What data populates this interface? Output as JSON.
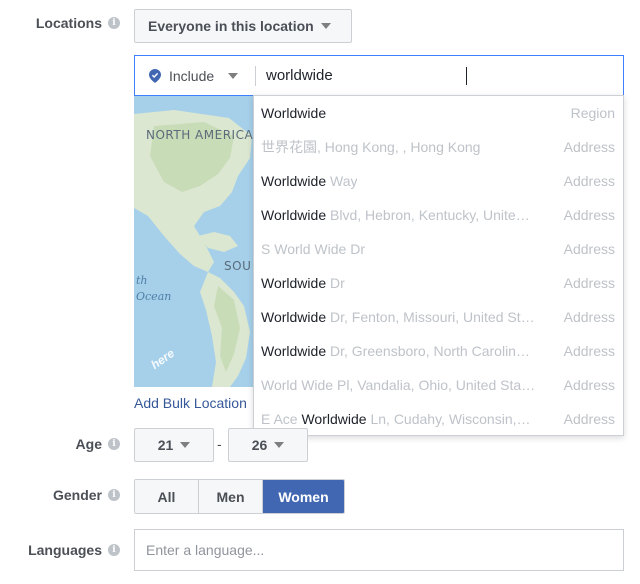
{
  "labels": {
    "locations": "Locations",
    "age": "Age",
    "gender": "Gender",
    "languages": "Languages",
    "info_glyph": "i"
  },
  "audience_type": "Everyone in this location",
  "location_search": {
    "mode": "Include",
    "query": "worldwide"
  },
  "map": {
    "labels": [
      "NORTH AMERICA",
      "SOU"
    ],
    "ocean": [
      "th",
      "Ocean"
    ],
    "provider_logo": "here"
  },
  "bulk_link": "Add Bulk Location",
  "suggestions": [
    {
      "match": "Worldwide",
      "rest": "",
      "type": "Region",
      "match_first": true
    },
    {
      "match": "",
      "rest": "世界花園, Hong Kong, , Hong Kong",
      "type": "Address",
      "match_first": true
    },
    {
      "match": "Worldwide",
      "rest": " Way",
      "type": "Address",
      "match_first": true
    },
    {
      "match": "Worldwide",
      "rest": " Blvd, Hebron, Kentucky, Unite…",
      "type": "Address",
      "match_first": true
    },
    {
      "match": "",
      "rest": "S World Wide Dr",
      "type": "Address",
      "match_first": true
    },
    {
      "match": "Worldwide",
      "rest": " Dr",
      "type": "Address",
      "match_first": true
    },
    {
      "match": "Worldwide",
      "rest": " Dr, Fenton, Missouri, United St…",
      "type": "Address",
      "match_first": true
    },
    {
      "match": "Worldwide",
      "rest": " Dr, Greensboro, North Carolin…",
      "type": "Address",
      "match_first": true
    },
    {
      "match": "",
      "rest": "World Wide Pl, Vandalia, Ohio, United Sta…",
      "type": "Address",
      "match_first": true
    },
    {
      "prefix": "E Ace ",
      "match": "Worldwide",
      "rest": " Ln, Cudahy, Wisconsin,…",
      "type": "Address",
      "match_first": false
    }
  ],
  "age": {
    "min": "21",
    "max": "26",
    "separator": "-"
  },
  "gender": {
    "options": [
      "All",
      "Men",
      "Women"
    ],
    "selected": "Women"
  },
  "languages": {
    "placeholder": "Enter a language..."
  },
  "colors": {
    "accent": "#4267b2",
    "focus_border": "#4080ff",
    "link": "#365899",
    "map_water": "#a6d0ea"
  }
}
